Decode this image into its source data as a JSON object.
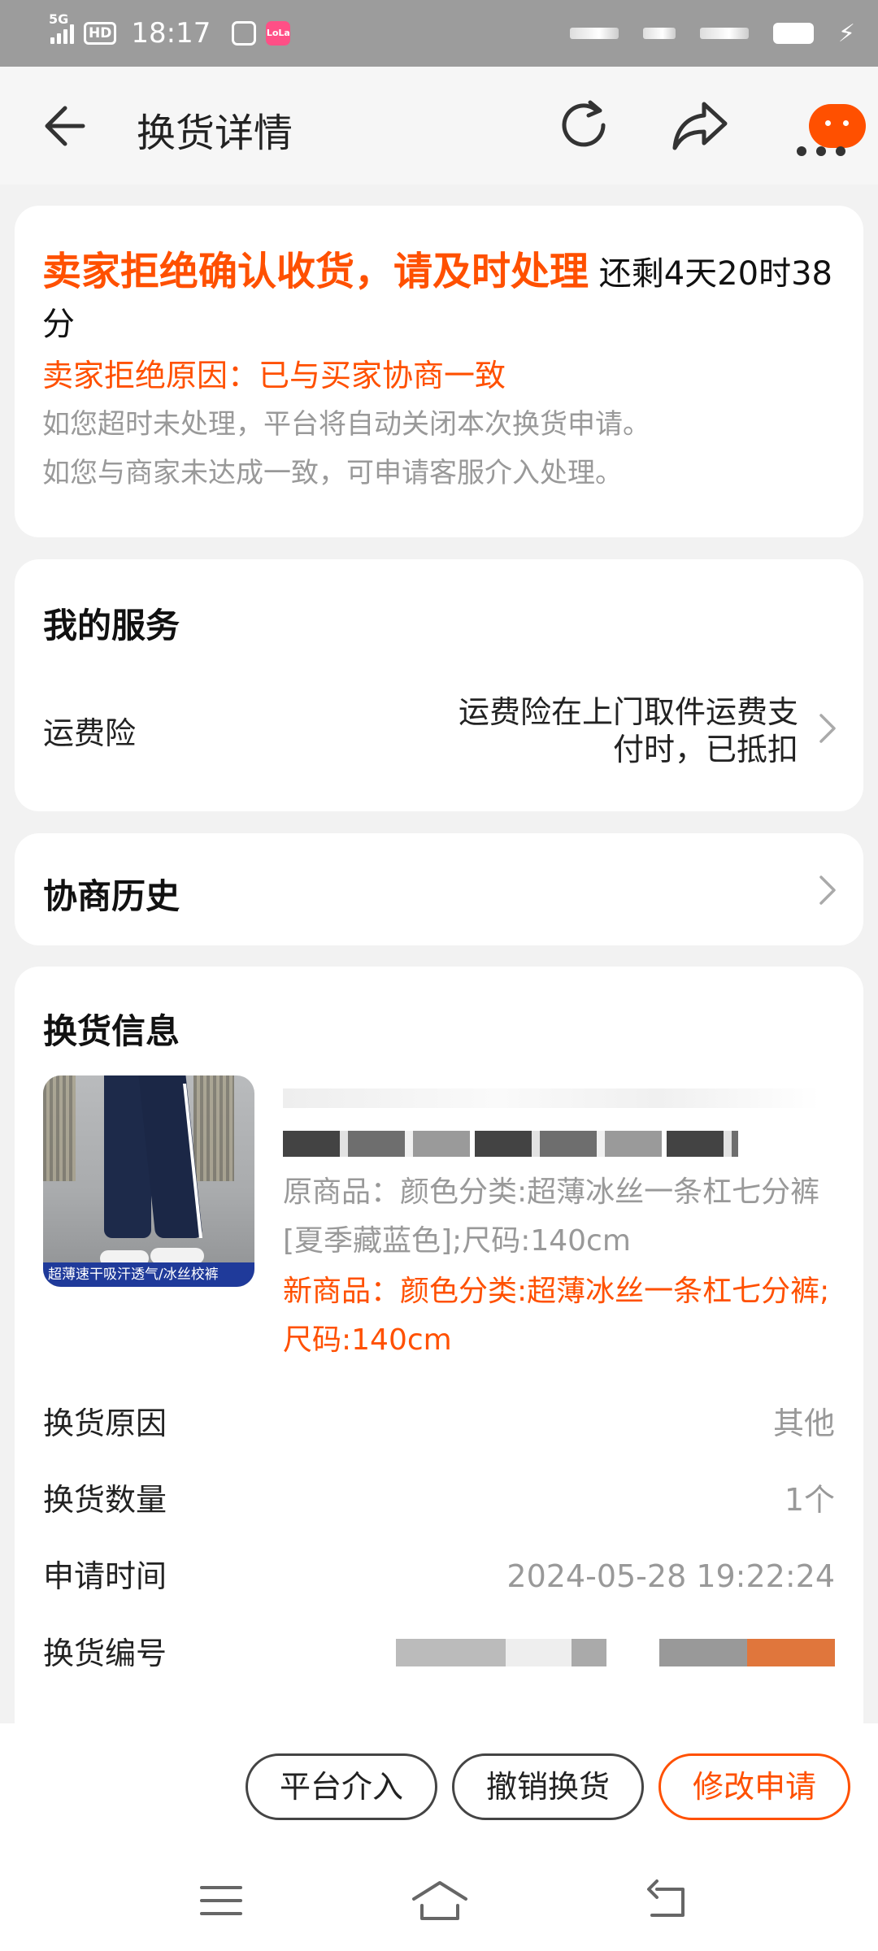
{
  "status_bar": {
    "network": "5G",
    "hd": "HD",
    "time": "18:17",
    "app_badge": "LoLa"
  },
  "header": {
    "title": "换货详情",
    "icons": [
      "back-arrow-icon",
      "refresh-icon",
      "share-icon",
      "more-icon"
    ]
  },
  "alert": {
    "title": "卖家拒绝确认收货，请及时处理",
    "countdown": "还剩4天20时38分",
    "reason": "卖家拒绝原因：已与买家协商一致",
    "note1": "如您超时未处理，平台将自动关闭本次换货申请。",
    "note2": "如您与商家未达成一致，可申请客服介入处理。"
  },
  "service": {
    "title": "我的服务",
    "label": "运费险",
    "value": "运费险在上门取件运费支付时，已抵扣"
  },
  "history": {
    "title": "协商历史"
  },
  "exchange": {
    "title": "换货信息",
    "image_banner": "超薄速干吸汗透气/冰丝校裤",
    "original": "原商品：颜色分类:超薄冰丝一条杠七分裤[夏季藏蓝色];尺码:140cm",
    "new": "新商品：颜色分类:超薄冰丝一条杠七分裤;尺码:140cm",
    "rows": [
      {
        "label": "换货原因",
        "value": "其他"
      },
      {
        "label": "换货数量",
        "value": "1个"
      },
      {
        "label": "申请时间",
        "value": "2024-05-28 19:22:24"
      },
      {
        "label": "换货编号",
        "value": ""
      }
    ]
  },
  "actions": {
    "platform": "平台介入",
    "cancel": "撤销换货",
    "modify": "修改申请"
  },
  "colors": {
    "accent": "#ff5000",
    "muted": "#999999",
    "background": "#f2f2f2"
  }
}
